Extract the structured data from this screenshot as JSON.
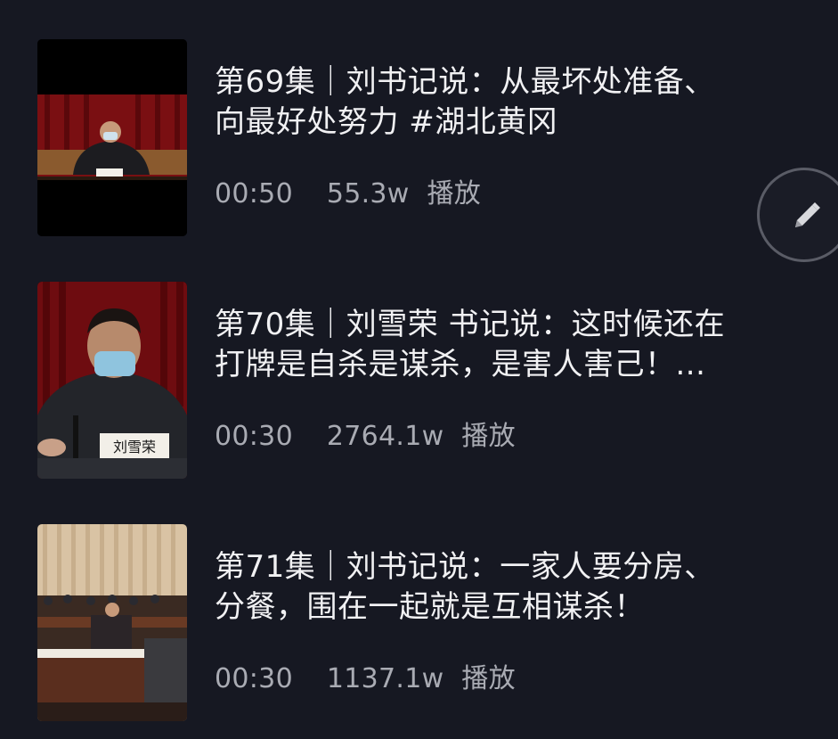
{
  "videos": [
    {
      "title": "第69集｜刘书记说：从最坏处准备、\n向最好处努力 #湖北黄冈",
      "duration": "00:50",
      "views": "55.3w",
      "play_label": "播放",
      "thumbnail": "leader-at-conference-table"
    },
    {
      "title": "第70集｜刘雪荣 书记说：这时候还在\n打牌是自杀是谋杀，是害人害己！...",
      "duration": "00:30",
      "views": "2764.1w",
      "play_label": "播放",
      "thumbnail": "leader-closeup-with-nameplate",
      "nameplate": "刘雪荣"
    },
    {
      "title": "第71集｜刘书记说：一家人要分房、\n分餐，围在一起就是互相谋杀！",
      "duration": "00:30",
      "views": "1137.1w",
      "play_label": "播放",
      "thumbnail": "meeting-hall-audience"
    }
  ],
  "floating_button": {
    "icon": "pencil-icon"
  },
  "colors": {
    "background": "#161822",
    "title_text": "#f1f1f3",
    "meta_text": "#a9abb3"
  }
}
